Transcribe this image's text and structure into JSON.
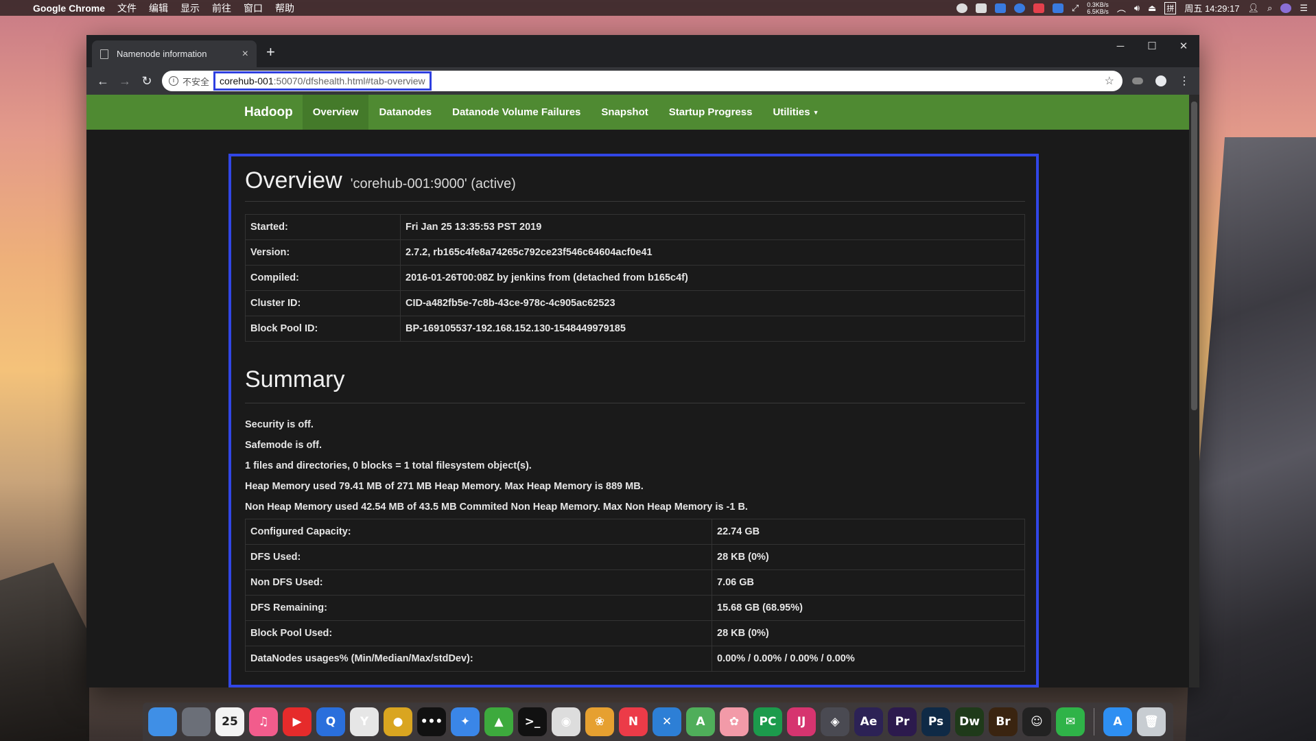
{
  "menubar": {
    "app_name": "Google Chrome",
    "menus": [
      "文件",
      "编辑",
      "显示",
      "前往",
      "窗口",
      "帮助"
    ],
    "net_up": "0.3KB/s",
    "net_down": "6.5KB/s",
    "ime": "拼",
    "clock": "周五 14:29:17"
  },
  "browser": {
    "tab_title": "Namenode information",
    "insecure_label": "不安全",
    "url_host": "corehub-001",
    "url_rest": ":50070/dfshealth.html#tab-overview"
  },
  "nav": {
    "brand": "Hadoop",
    "items": [
      {
        "label": "Overview",
        "active": true
      },
      {
        "label": "Datanodes"
      },
      {
        "label": "Datanode Volume Failures"
      },
      {
        "label": "Snapshot"
      },
      {
        "label": "Startup Progress"
      },
      {
        "label": "Utilities"
      }
    ]
  },
  "overview": {
    "title": "Overview",
    "subtitle": "'corehub-001:9000' (active)",
    "rows": [
      {
        "key": "Started:",
        "value": "Fri Jan 25 13:35:53 PST 2019"
      },
      {
        "key": "Version:",
        "value": "2.7.2, rb165c4fe8a74265c792ce23f546c64604acf0e41"
      },
      {
        "key": "Compiled:",
        "value": "2016-01-26T00:08Z by jenkins from (detached from b165c4f)"
      },
      {
        "key": "Cluster ID:",
        "value": "CID-a482fb5e-7c8b-43ce-978c-4c905ac62523"
      },
      {
        "key": "Block Pool ID:",
        "value": "BP-169105537-192.168.152.130-1548449979185"
      }
    ]
  },
  "summary": {
    "title": "Summary",
    "lines": [
      "Security is off.",
      "Safemode is off.",
      "1 files and directories, 0 blocks = 1 total filesystem object(s).",
      "Heap Memory used 79.41 MB of 271 MB Heap Memory. Max Heap Memory is 889 MB.",
      "Non Heap Memory used 42.54 MB of 43.5 MB Commited Non Heap Memory. Max Non Heap Memory is -1 B."
    ],
    "rows": [
      {
        "key": "Configured Capacity:",
        "value": "22.74 GB"
      },
      {
        "key": "DFS Used:",
        "value": "28 KB (0%)"
      },
      {
        "key": "Non DFS Used:",
        "value": "7.06 GB"
      },
      {
        "key": "DFS Remaining:",
        "value": "15.68 GB (68.95%)"
      },
      {
        "key": "Block Pool Used:",
        "value": "28 KB (0%)"
      },
      {
        "key": "DataNodes usages% (Min/Median/Max/stdDev):",
        "value": "0.00% / 0.00% / 0.00% / 0.00%"
      }
    ]
  },
  "dock": {
    "calendar_day": "25",
    "items": [
      {
        "name": "finder-icon",
        "color": "#3f8fe6",
        "glyph": ""
      },
      {
        "name": "launchpad-icon",
        "color": "#6b6f78",
        "glyph": ""
      },
      {
        "name": "calendar-icon",
        "color": "#f3f3f3",
        "glyph": ""
      },
      {
        "name": "music-icon",
        "color": "#f25c8c",
        "glyph": "♫"
      },
      {
        "name": "youtube-icon",
        "color": "#e62b2b",
        "glyph": "▶"
      },
      {
        "name": "q-browser-icon",
        "color": "#2a6fdc",
        "glyph": "Q"
      },
      {
        "name": "yandex-icon",
        "color": "#e6e6e6",
        "glyph": "Y"
      },
      {
        "name": "chrome-icon",
        "color": "#d9a520",
        "glyph": "●"
      },
      {
        "name": "dots-icon",
        "color": "#111111",
        "glyph": "•••"
      },
      {
        "name": "safari-icon",
        "color": "#3a86e8",
        "glyph": "✦"
      },
      {
        "name": "android-icon",
        "color": "#3daa3d",
        "glyph": "▲"
      },
      {
        "name": "terminal-icon",
        "color": "#111111",
        "glyph": ">_"
      },
      {
        "name": "github-icon",
        "color": "#dddddd",
        "glyph": "◉"
      },
      {
        "name": "photos-icon",
        "color": "#e6a030",
        "glyph": "❀"
      },
      {
        "name": "news-icon",
        "color": "#ec3b48",
        "glyph": "N"
      },
      {
        "name": "xcode-icon",
        "color": "#2d7fd6",
        "glyph": "✕"
      },
      {
        "name": "android-studio-icon",
        "color": "#4fae5a",
        "glyph": "A"
      },
      {
        "name": "mindnode-icon",
        "color": "#f29aa8",
        "glyph": "✿"
      },
      {
        "name": "pycharm-icon",
        "color": "#1c9b4c",
        "glyph": "PC"
      },
      {
        "name": "intellij-icon",
        "color": "#d6346f",
        "glyph": "IJ"
      },
      {
        "name": "davinci-icon",
        "color": "#4a4a52",
        "glyph": "◈"
      },
      {
        "name": "after-effects-icon",
        "color": "#2c2255",
        "glyph": "Ae"
      },
      {
        "name": "premiere-icon",
        "color": "#2c1a4d",
        "glyph": "Pr"
      },
      {
        "name": "photoshop-icon",
        "color": "#0f2a46",
        "glyph": "Ps"
      },
      {
        "name": "dreamweaver-icon",
        "color": "#1f3a1a",
        "glyph": "Dw"
      },
      {
        "name": "bridge-icon",
        "color": "#3a2410",
        "glyph": "Br"
      },
      {
        "name": "qq-icon",
        "color": "#222222",
        "glyph": "☺"
      },
      {
        "name": "wechat-icon",
        "color": "#2fb348",
        "glyph": "✉"
      },
      {
        "name": "app-store-icon",
        "color": "#2e8ff2",
        "glyph": "A"
      },
      {
        "name": "trash-icon",
        "color": "#c8cdd2",
        "glyph": "🗑"
      }
    ]
  }
}
